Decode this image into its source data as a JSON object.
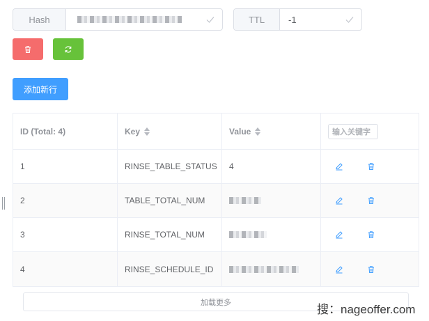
{
  "hash": {
    "label": "Hash",
    "value": ""
  },
  "ttl": {
    "label": "TTL",
    "value": "-1"
  },
  "toolbar": {
    "add_row_label": "添加新行"
  },
  "table": {
    "headers": {
      "id": "ID (Total: 4)",
      "key": "Key",
      "value": "Value"
    },
    "search_placeholder": "输入关键字",
    "rows": [
      {
        "id": "1",
        "key": "RINSE_TABLE_STATUS",
        "value": "4"
      },
      {
        "id": "2",
        "key": "TABLE_TOTAL_NUM",
        "value": ""
      },
      {
        "id": "3",
        "key": "RINSE_TOTAL_NUM",
        "value": ""
      },
      {
        "id": "4",
        "key": "RINSE_SCHEDULE_ID",
        "value": ""
      }
    ]
  },
  "load_more_label": "加载更多",
  "watermark": "搜：nageoffer.com",
  "colors": {
    "danger": "#f56c6c",
    "success": "#67c23a",
    "primary": "#409eff",
    "icon": "#409eff"
  },
  "icons": {
    "delete": "trash-icon",
    "refresh": "refresh-icon",
    "edit": "edit-icon",
    "row_delete": "trash-icon"
  }
}
